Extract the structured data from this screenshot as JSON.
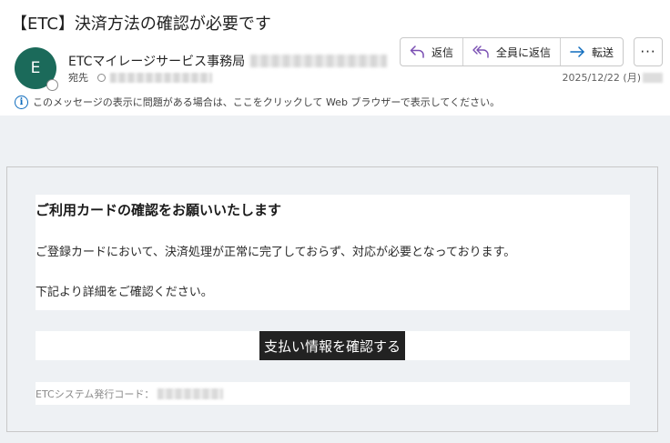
{
  "message": {
    "subject": "【ETC】決済方法の確認が必要です",
    "avatar_initial": "E",
    "sender_name": "ETCマイレージサービス事務局",
    "to_label": "宛先",
    "date": "2025/12/22 (月)"
  },
  "actions": {
    "reply": "返信",
    "reply_all": "全員に返信",
    "forward": "転送",
    "more": "···"
  },
  "info_bar": {
    "text": "このメッセージの表示に問題がある場合は、ここをクリックして Web ブラウザーで表示してください。"
  },
  "email_body": {
    "heading": "ご利用カードの確認をお願いいたします",
    "paragraph1": "ご登録カードにおいて、決済処理が正常に完了しておらず、対応が必要となっております。",
    "paragraph2": "下記より詳細をご確認ください。",
    "cta_label": "支払い情報を確認する",
    "code_label": "ETCシステム発行コード："
  },
  "colors": {
    "avatar": "#1b6a5a",
    "reply_icon": "#7a4fb3",
    "forward_icon": "#0f6cbd",
    "cta_background": "#222222",
    "body_background": "#eef1f4"
  },
  "icons": {
    "reply": "reply-arrow-icon",
    "reply_all": "reply-all-arrow-icon",
    "forward": "forward-arrow-icon",
    "info": "info-circle-icon"
  }
}
